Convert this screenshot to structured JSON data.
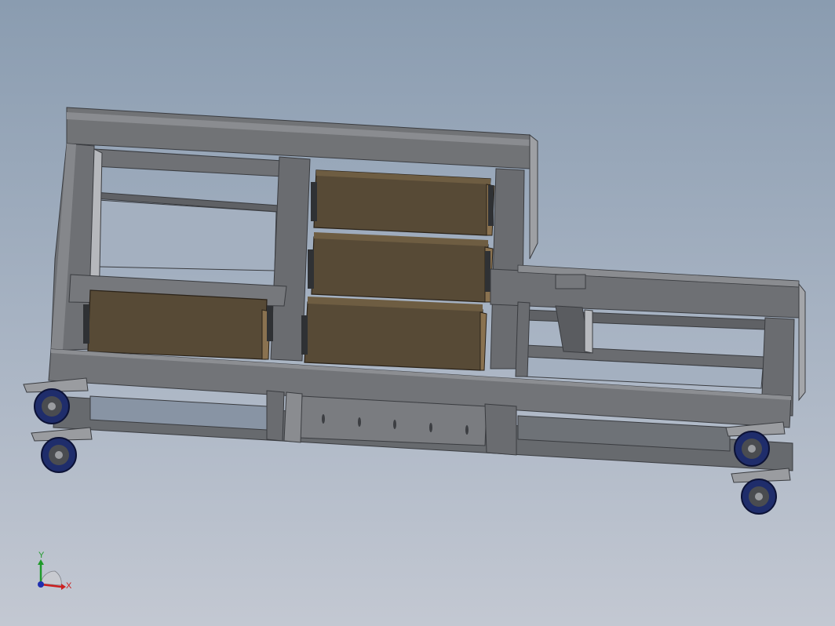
{
  "viewport": {
    "background_top": "#8a9cb0",
    "background_bottom": "#c3c8d2"
  },
  "model": {
    "frame_color": "#6b6d70",
    "frame_dark": "#4e5054",
    "frame_light": "#85878b",
    "drawer_color": "#574a36",
    "drawer_edge": "#8a7250",
    "caster_wheel": "#1f2d6b",
    "caster_hub": "#9a9ca0",
    "drawers_left_bay": 1,
    "drawers_middle_bay": 3,
    "casters": 4
  },
  "triad": {
    "x_label": "X",
    "y_label": "Y",
    "x_color": "#cc1f1f",
    "y_color": "#1f9a2a",
    "z_color": "#1f2fb0"
  }
}
